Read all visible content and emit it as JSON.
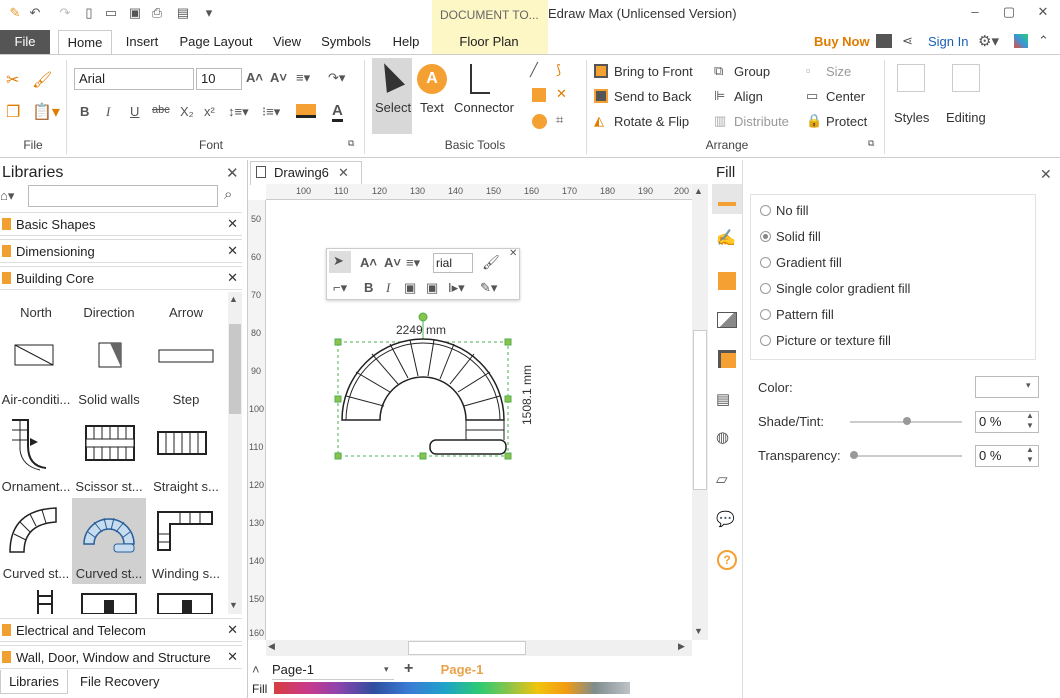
{
  "app": {
    "doc_tab": "DOCUMENT TO...",
    "title": "Edraw Max (Unlicensed Version)"
  },
  "menu": {
    "file": "File",
    "tabs": [
      "Home",
      "Insert",
      "Page Layout",
      "View",
      "Symbols",
      "Help",
      "Floor Plan"
    ],
    "buy_now": "Buy Now",
    "sign_in": "Sign In"
  },
  "ribbon": {
    "groups": {
      "file": "File",
      "font": "Font",
      "basic_tools": "Basic Tools",
      "arrange": "Arrange"
    },
    "font_name": "Arial",
    "font_size": "10",
    "tools": {
      "select": "Select",
      "text": "Text",
      "connector": "Connector"
    },
    "arrange": {
      "bring_front": "Bring to Front",
      "send_back": "Send to Back",
      "rotate_flip": "Rotate & Flip",
      "group": "Group",
      "align": "Align",
      "distribute": "Distribute",
      "size": "Size",
      "center": "Center",
      "protect": "Protect"
    },
    "styles": "Styles",
    "editing": "Editing"
  },
  "libraries": {
    "title": "Libraries",
    "sections": [
      "Basic Shapes",
      "Dimensioning",
      "Building Core"
    ],
    "shapes": [
      {
        "label": "North"
      },
      {
        "label": "Direction"
      },
      {
        "label": "Arrow"
      },
      {
        "label": "Air-conditi..."
      },
      {
        "label": "Solid walls"
      },
      {
        "label": "Step"
      },
      {
        "label": "Ornament..."
      },
      {
        "label": "Scissor st..."
      },
      {
        "label": "Straight s..."
      },
      {
        "label": "Curved st..."
      },
      {
        "label": "Curved st..."
      },
      {
        "label": "Winding s..."
      }
    ],
    "bottom_sections": [
      "Electrical and Telecom",
      "Wall, Door, Window and Structure"
    ],
    "tabs": [
      "Libraries",
      "File Recovery"
    ]
  },
  "canvas": {
    "tab": "Drawing6",
    "ruler_h": [
      "100",
      "110",
      "120",
      "130",
      "140",
      "150",
      "160",
      "170",
      "180",
      "190",
      "200"
    ],
    "ruler_v": [
      "50",
      "60",
      "70",
      "80",
      "90",
      "100",
      "110",
      "120",
      "130",
      "140",
      "150",
      "160"
    ],
    "width_dim": "2249 mm",
    "height_dim": "1508.1 mm",
    "mini_font": "rial"
  },
  "pages": {
    "page_select": "Page-1",
    "active_page": "Page-1",
    "fill_label": "Fill"
  },
  "fill": {
    "title": "Fill",
    "options": [
      "No fill",
      "Solid fill",
      "Gradient fill",
      "Single color gradient fill",
      "Pattern fill",
      "Picture or texture fill"
    ],
    "selected": "Solid fill",
    "color_label": "Color:",
    "shade_label": "Shade/Tint:",
    "shade_value": "0 %",
    "transparency_label": "Transparency:",
    "transparency_value": "0 %"
  },
  "colors": {
    "accent": "#f5a033",
    "file_tab": "#555555",
    "doc_tab": "#fdf6c5",
    "selection": "#4caf50",
    "buy_now": "#e07b00"
  }
}
